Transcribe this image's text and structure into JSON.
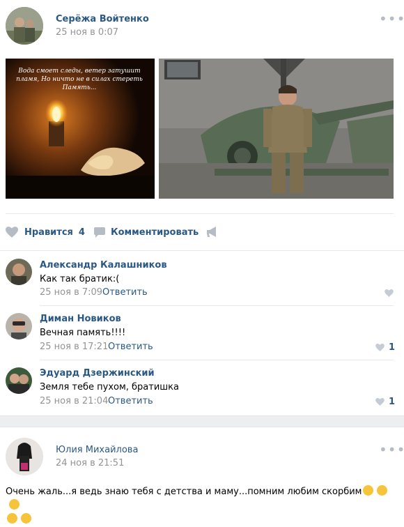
{
  "post": {
    "author": "Серёжа Войтенко",
    "date": "25 ноя в 0:07",
    "photo1_caption": "Вода смоет следы, ветер затушит пламя, Но ничто не в силах стереть Память...",
    "actions": {
      "like_label": "Нравится",
      "like_count": "4",
      "comment_label": "Комментировать"
    }
  },
  "comments": [
    {
      "author": "Александр Калашников",
      "text": "Как так братик:(",
      "date": "25 ноя в 7:09",
      "reply": "Ответить",
      "likes": ""
    },
    {
      "author": "Диман Новиков",
      "text": "Вечная память!!!!",
      "date": "25 ноя в 17:21",
      "reply": "Ответить",
      "likes": "1"
    },
    {
      "author": "Эдуард Дзержинский",
      "text": "Земля тебе пухом, братишка",
      "date": "25 ноя в 21:04",
      "reply": "Ответить",
      "likes": "1"
    }
  ],
  "post2": {
    "author": "Юлия Михайлова",
    "date": "24 ноя в 21:51",
    "text": "Очень жаль...я ведь знаю тебя с детства и маму...помним любим скорбим"
  },
  "colors": {
    "link": "#2a5885",
    "meta": "#939393",
    "icon": "#b5bcc6",
    "divider": "#e7e8ec",
    "gap": "#edeef0"
  }
}
